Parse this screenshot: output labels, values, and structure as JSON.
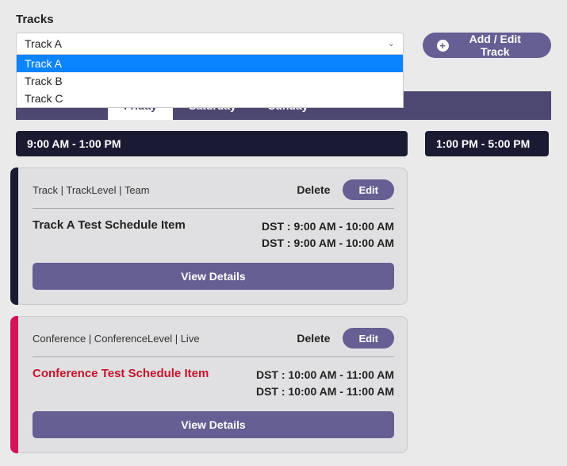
{
  "labels": {
    "tracks": "Tracks",
    "addEditTrack": "Add / Edit Track"
  },
  "select": {
    "value": "Track A",
    "options": [
      "Track A",
      "Track B",
      "Track C"
    ],
    "selectedIndex": 0
  },
  "tabs": {
    "items": [
      "Friday",
      "Saturday",
      "Sunday"
    ],
    "active": 0
  },
  "columns": {
    "left": {
      "header": "9:00 AM - 1:00 PM"
    },
    "right": {
      "header": "1:00 PM - 5:00 PM"
    }
  },
  "cards": [
    {
      "meta": "Track | TrackLevel | Team",
      "deleteLabel": "Delete",
      "editLabel": "Edit",
      "title": "Track A Test Schedule Item",
      "times": [
        "DST : 9:00 AM - 10:00 AM",
        "DST : 9:00 AM - 10:00 AM"
      ],
      "viewDetails": "View Details",
      "accent": "dark"
    },
    {
      "meta": "Conference | ConferenceLevel | Live",
      "deleteLabel": "Delete",
      "editLabel": "Edit",
      "title": "Conference Test Schedule Item",
      "times": [
        "DST : 10:00 AM - 11:00 AM",
        "DST : 10:00 AM - 11:00 AM"
      ],
      "viewDetails": "View Details",
      "accent": "pink"
    }
  ],
  "colors": {
    "navy": "#1a1b33",
    "purple": "#665f94",
    "navbar": "#4d4872",
    "pink": "#d4145a",
    "highlight": "#0a84ff"
  }
}
